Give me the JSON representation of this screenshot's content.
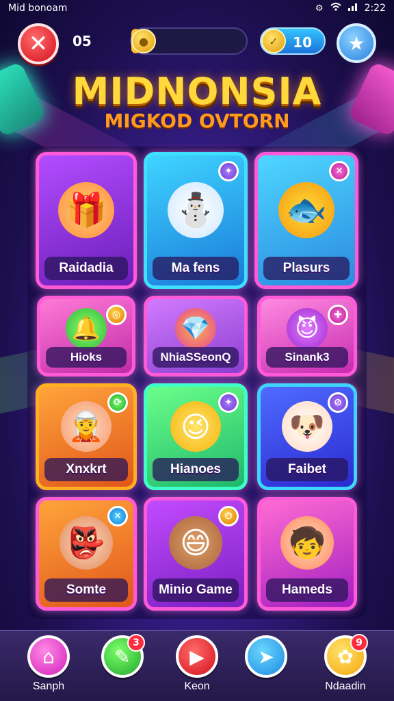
{
  "status_bar": {
    "carrier": "Mid bonoam",
    "time": "2:22"
  },
  "header": {
    "level": "05",
    "coins": "10",
    "progress": 0.08
  },
  "title": {
    "line1": "MIDNONSIA",
    "line2": "MIGKOD OVTORN"
  },
  "tiles": [
    {
      "label": "Raidadia",
      "icon": "gift-boxes-and-kids-icon",
      "face": "🎁"
    },
    {
      "label": "Ma fens",
      "icon": "snowman-with-hat-icon",
      "face": "⛄"
    },
    {
      "label": "Plasurs",
      "icon": "fish-creature-icon",
      "face": "🐟"
    },
    {
      "label": "Hioks",
      "icon": "green-bell-icon",
      "face": "🔔"
    },
    {
      "label": "NhiaSSeonQ",
      "icon": "gem-cube-icon",
      "face": "💎"
    },
    {
      "label": "Sinank3",
      "icon": "purple-creature-icon",
      "face": "😈"
    },
    {
      "label": "Xnxkrt",
      "icon": "elf-kid-icon",
      "face": "🧝"
    },
    {
      "label": "Hianoes",
      "icon": "winking-smiley-icon",
      "face": "😉"
    },
    {
      "label": "Faibet",
      "icon": "puppy-face-icon",
      "face": "🐶"
    },
    {
      "label": "Somte",
      "icon": "goblin-kid-icon",
      "face": "👺"
    },
    {
      "label": "Minio Game",
      "icon": "smiling-boy-icon",
      "face": "😄"
    },
    {
      "label": "Hameds",
      "icon": "redhead-kid-icon",
      "face": "🧒"
    }
  ],
  "bottom_nav": [
    {
      "label": "Sanph",
      "icon": "home-icon",
      "glyph": "⌂",
      "badge": ""
    },
    {
      "label": "",
      "icon": "pencil-icon",
      "glyph": "✎",
      "badge": "3"
    },
    {
      "label": "Keon",
      "icon": "play-icon",
      "glyph": "▶",
      "badge": ""
    },
    {
      "label": "",
      "icon": "send-icon",
      "glyph": "➤",
      "badge": ""
    },
    {
      "label": "Ndaadin",
      "icon": "flower-icon",
      "glyph": "✿",
      "badge": "9"
    }
  ],
  "colors": {
    "accent": "#ff5ad8",
    "gold": "#ffd93b",
    "background": "#3a1f8e"
  }
}
